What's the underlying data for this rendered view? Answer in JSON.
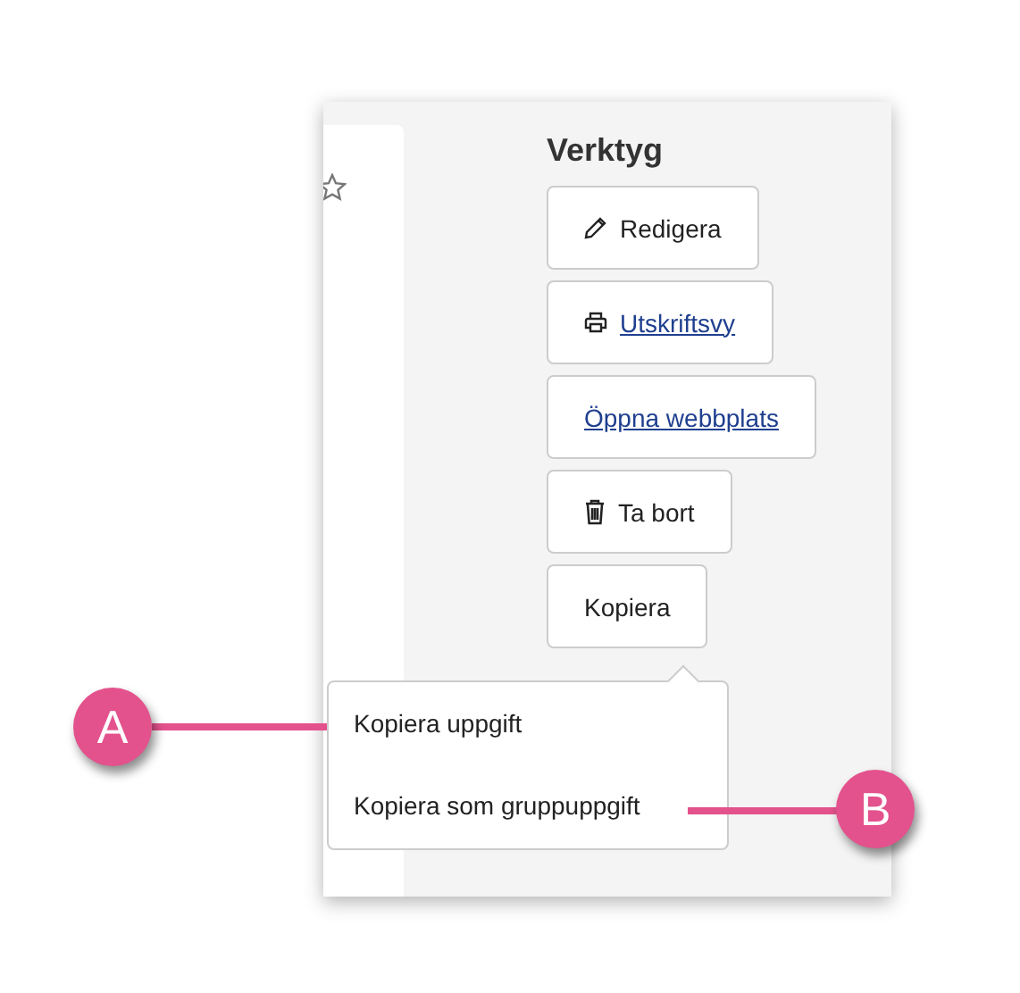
{
  "panel": {
    "title": "Verktyg",
    "buttons": [
      {
        "label": "Redigera",
        "kind": "pencil",
        "link": false
      },
      {
        "label": "Utskriftsvy",
        "kind": "printer",
        "link": true
      },
      {
        "label": "Öppna webbplats",
        "kind": "plain",
        "link": true
      },
      {
        "label": "Ta bort",
        "kind": "trash",
        "link": false
      },
      {
        "label": "Kopiera",
        "kind": "plain",
        "link": false
      }
    ],
    "menu": [
      {
        "label": "Kopiera uppgift"
      },
      {
        "label": "Kopiera som gruppuppgift"
      }
    ]
  },
  "callouts": [
    {
      "label": "A"
    },
    {
      "label": "B"
    }
  ]
}
